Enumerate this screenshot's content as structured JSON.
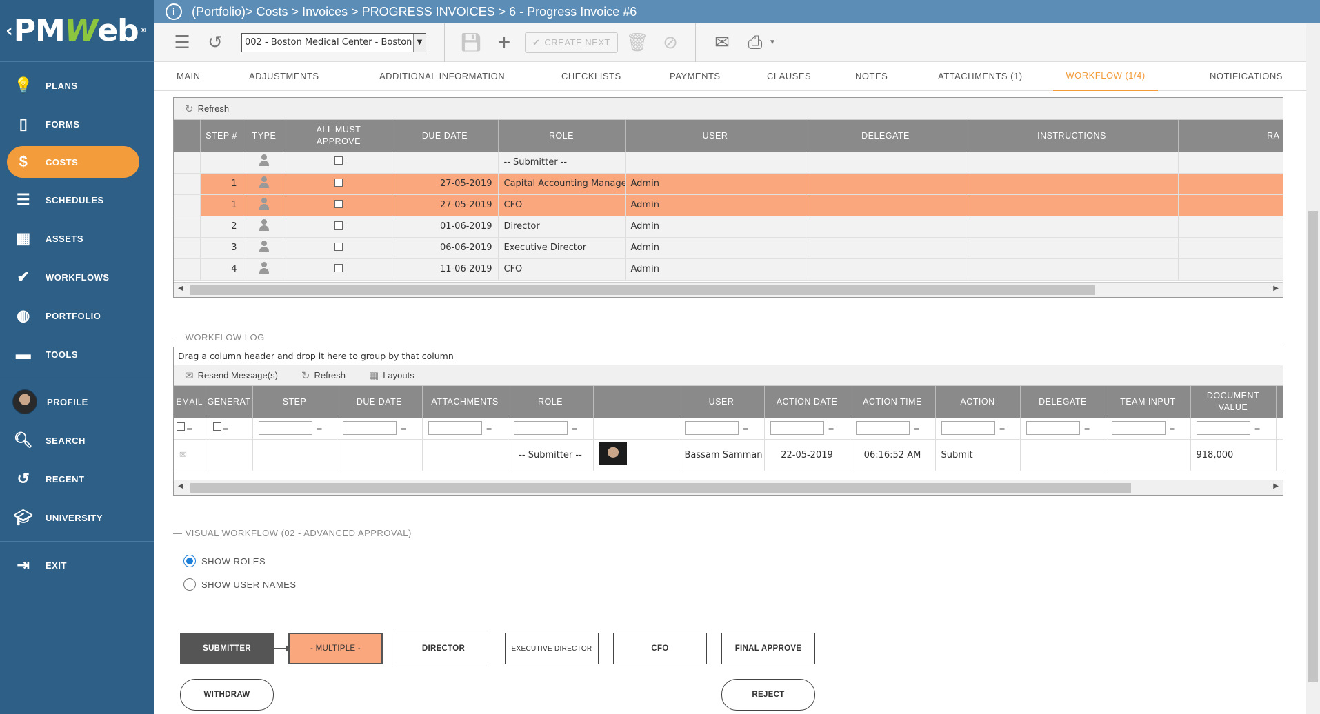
{
  "app": {
    "logo_pm": "PM",
    "logo_w": "W",
    "logo_eb": "eb",
    "logo_reg": "®"
  },
  "sidebar": {
    "items": [
      {
        "label": "PLANS",
        "icon": "bulb-icon"
      },
      {
        "label": "FORMS",
        "icon": "form-icon"
      },
      {
        "label": "COSTS",
        "icon": "dollar-icon"
      },
      {
        "label": "SCHEDULES",
        "icon": "schedule-icon"
      },
      {
        "label": "ASSETS",
        "icon": "building-icon"
      },
      {
        "label": "WORKFLOWS",
        "icon": "check-icon"
      },
      {
        "label": "PORTFOLIO",
        "icon": "globe-icon"
      },
      {
        "label": "TOOLS",
        "icon": "toolbox-icon"
      },
      {
        "label": "PROFILE",
        "icon": "avatar"
      },
      {
        "label": "SEARCH",
        "icon": "search-icon"
      },
      {
        "label": "RECENT",
        "icon": "history-icon"
      },
      {
        "label": "UNIVERSITY",
        "icon": "graduation-icon"
      },
      {
        "label": "EXIT",
        "icon": "exit-icon"
      }
    ]
  },
  "breadcrumb": {
    "root": "(Portfolio)",
    "rest": " > Costs > Invoices > PROGRESS INVOICES > 6 - Progress Invoice #6"
  },
  "toolbar": {
    "project": "002 - Boston Medical Center - Boston",
    "create_next": "CREATE NEXT"
  },
  "tabs": [
    "MAIN",
    "ADJUSTMENTS",
    "ADDITIONAL INFORMATION",
    "CHECKLISTS",
    "PAYMENTS",
    "CLAUSES",
    "NOTES",
    "ATTACHMENTS (1)",
    "WORKFLOW (1/4)",
    "NOTIFICATIONS"
  ],
  "steps_grid": {
    "refresh": "Refresh",
    "headers": [
      "STEP #",
      "TYPE",
      "ALL MUST APPROVE",
      "DUE DATE",
      "ROLE",
      "USER",
      "DELEGATE",
      "INSTRUCTIONS",
      "RA"
    ],
    "rows": [
      {
        "step": "",
        "due": "",
        "role": "-- Submitter --",
        "user": "",
        "style": "gray"
      },
      {
        "step": "1",
        "due": "27-05-2019",
        "role": "Capital Accounting Manager",
        "user": "Admin",
        "style": "hl"
      },
      {
        "step": "1",
        "due": "27-05-2019",
        "role": "CFO",
        "user": "Admin",
        "style": "hl"
      },
      {
        "step": "2",
        "due": "01-06-2019",
        "role": "Director",
        "user": "Admin",
        "style": "gray"
      },
      {
        "step": "3",
        "due": "06-06-2019",
        "role": "Executive Director",
        "user": "Admin",
        "style": "gray"
      },
      {
        "step": "4",
        "due": "11-06-2019",
        "role": "CFO",
        "user": "Admin",
        "style": "gray"
      }
    ]
  },
  "workflow_log": {
    "section": "WORKFLOW LOG",
    "group_hint": "Drag a column header and drop it here to group by that column",
    "resend": "Resend Message(s)",
    "refresh": "Refresh",
    "layouts": "Layouts",
    "headers": [
      "EMAIL",
      "GENERAT",
      "STEP",
      "DUE DATE",
      "ATTACHMENTS",
      "ROLE",
      "",
      "USER",
      "ACTION DATE",
      "ACTION TIME",
      "ACTION",
      "DELEGATE",
      "TEAM INPUT",
      "DOCUMENT VALUE"
    ],
    "row": {
      "role": "-- Submitter --",
      "user": "Bassam Samman",
      "action_date": "22-05-2019",
      "action_time": "06:16:52 AM",
      "action": "Submit",
      "document_value": "918,000"
    }
  },
  "visual_workflow": {
    "section": "VISUAL WORKFLOW (02 - ADVANCED APPROVAL)",
    "show_roles": "SHOW ROLES",
    "show_user_names": "SHOW USER NAMES",
    "nodes": [
      "SUBMITTER",
      "- MULTIPLE -",
      "DIRECTOR",
      "EXECUTIVE DIRECTOR",
      "CFO",
      "FINAL APPROVE"
    ],
    "withdraw": "WITHDRAW",
    "reject": "REJECT"
  }
}
